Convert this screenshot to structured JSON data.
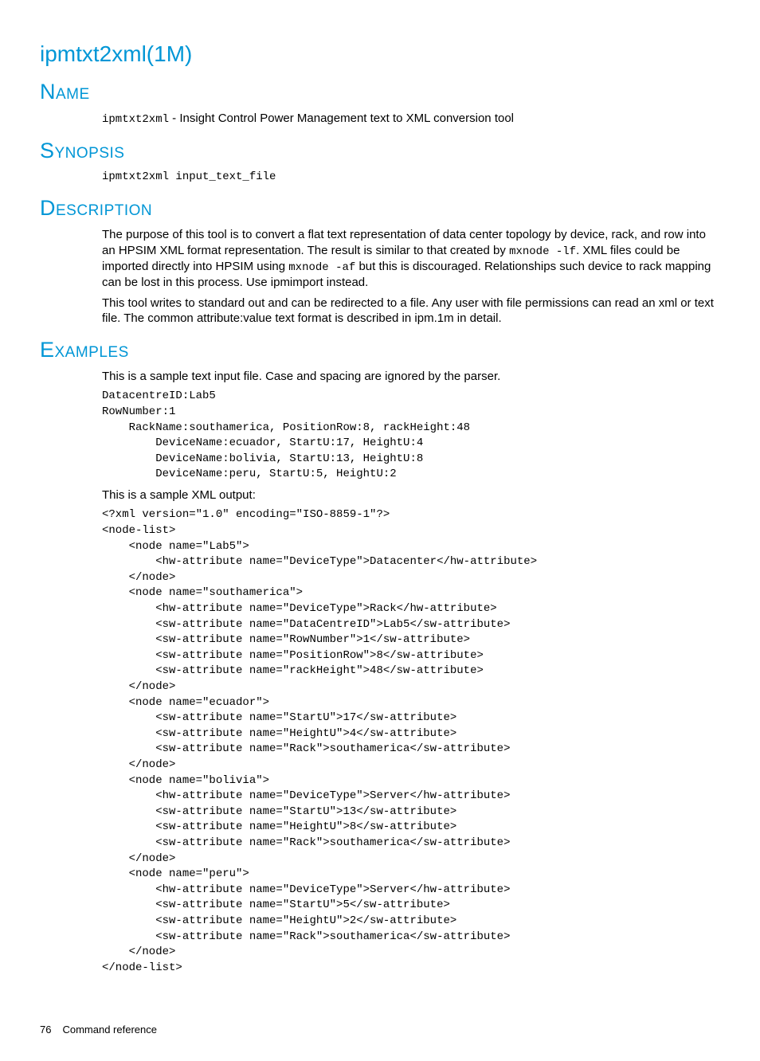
{
  "title": "ipmtxt2xml(1M)",
  "sections": {
    "name": {
      "heading": "Name",
      "cmd": "ipmtxt2xml",
      "desc": " - Insight Control Power Management text to XML conversion tool"
    },
    "synopsis": {
      "heading": "Synopsis",
      "text": "ipmtxt2xml input_text_file"
    },
    "description": {
      "heading": "Description",
      "p1a": "The purpose of this tool is to convert a flat text representation of data center topology by device, rack, and row into an HPSIM XML format representation. The result is similar to that created by ",
      "code1": "mxnode -lf",
      "p1b": ". XML files could be imported directly into HPSIM using ",
      "code2": "mxnode -af",
      "p1c": " but this is discouraged. Relationships such device to rack mapping can be lost in this process. Use ipmimport instead.",
      "p2": "This tool writes to standard out and can be redirected to a file. Any user with file permissions can read an xml or text file. The common attribute:value text format is described in ipm.1m in detail."
    },
    "examples": {
      "heading": "Examples",
      "intro1": "This is a sample text input file. Case and spacing are ignored by the parser.",
      "sample_text": "DatacentreID:Lab5\nRowNumber:1\n    RackName:southamerica, PositionRow:8, rackHeight:48\n        DeviceName:ecuador, StartU:17, HeightU:4\n        DeviceName:bolivia, StartU:13, HeightU:8\n        DeviceName:peru, StartU:5, HeightU:2",
      "intro2": "This is a sample XML output:",
      "sample_xml": "<?xml version=\"1.0\" encoding=\"ISO-8859-1\"?>\n<node-list>\n    <node name=\"Lab5\">\n        <hw-attribute name=\"DeviceType\">Datacenter</hw-attribute>\n    </node>\n    <node name=\"southamerica\">\n        <hw-attribute name=\"DeviceType\">Rack</hw-attribute>\n        <sw-attribute name=\"DataCentreID\">Lab5</sw-attribute>\n        <sw-attribute name=\"RowNumber\">1</sw-attribute>\n        <sw-attribute name=\"PositionRow\">8</sw-attribute>\n        <sw-attribute name=\"rackHeight\">48</sw-attribute>\n    </node>\n    <node name=\"ecuador\">\n        <sw-attribute name=\"StartU\">17</sw-attribute>\n        <sw-attribute name=\"HeightU\">4</sw-attribute>\n        <sw-attribute name=\"Rack\">southamerica</sw-attribute>\n    </node>\n    <node name=\"bolivia\">\n        <hw-attribute name=\"DeviceType\">Server</hw-attribute>\n        <sw-attribute name=\"StartU\">13</sw-attribute>\n        <sw-attribute name=\"HeightU\">8</sw-attribute>\n        <sw-attribute name=\"Rack\">southamerica</sw-attribute>\n    </node>\n    <node name=\"peru\">\n        <hw-attribute name=\"DeviceType\">Server</hw-attribute>\n        <sw-attribute name=\"StartU\">5</sw-attribute>\n        <sw-attribute name=\"HeightU\">2</sw-attribute>\n        <sw-attribute name=\"Rack\">southamerica</sw-attribute>\n    </node>\n</node-list>"
    }
  },
  "footer": {
    "page": "76",
    "label": "Command reference"
  }
}
